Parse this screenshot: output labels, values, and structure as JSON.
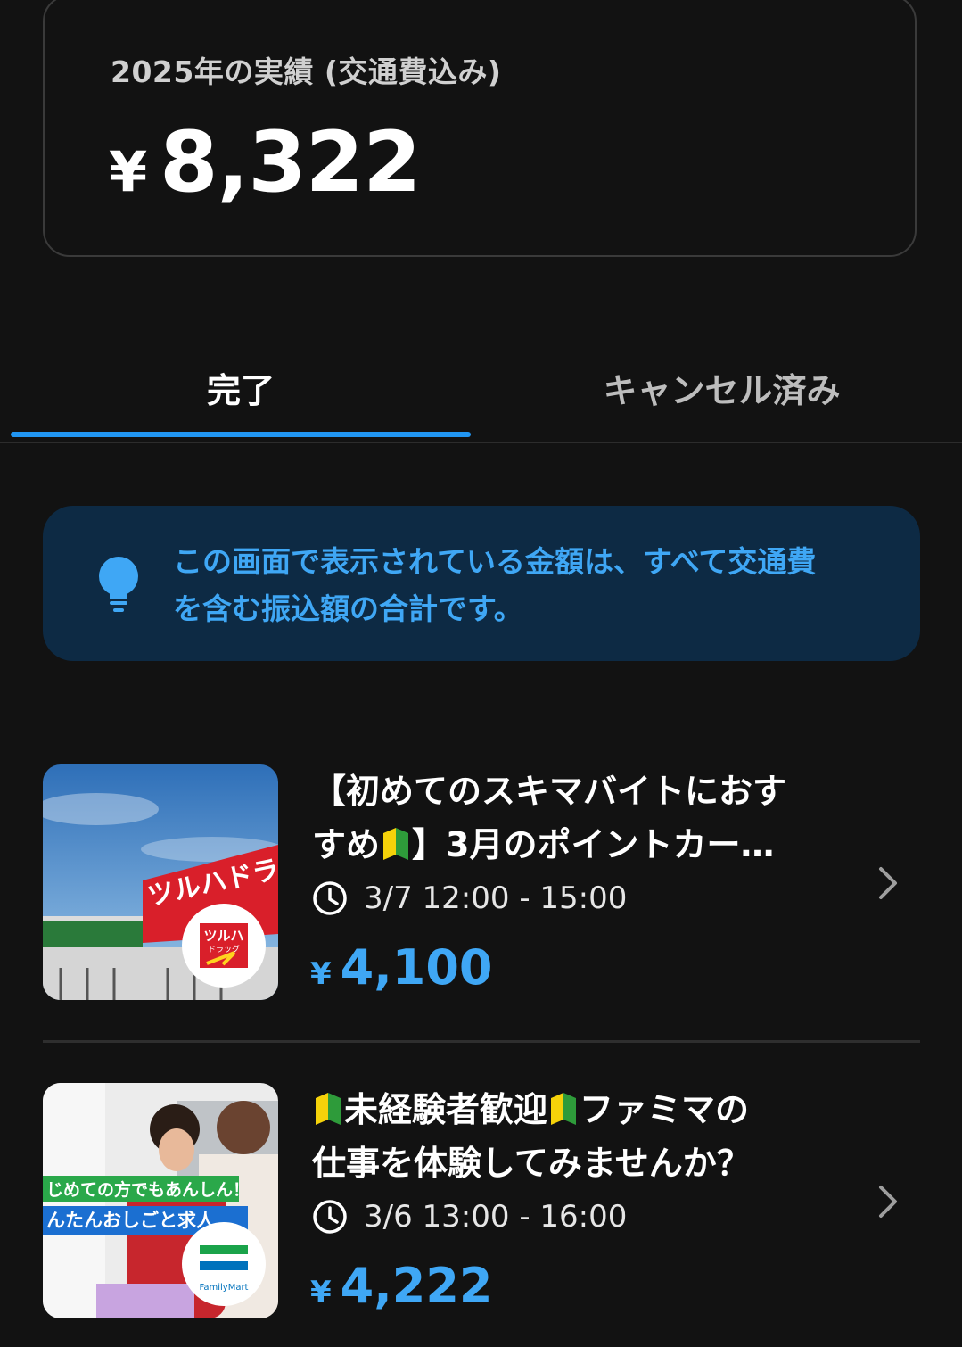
{
  "summary": {
    "label": "2025年の実績 (交通費込み)",
    "currency": "¥",
    "amount": "8,322"
  },
  "tabs": [
    {
      "label": "完了",
      "active": true
    },
    {
      "label": "キャンセル済み",
      "active": false
    }
  ],
  "info": {
    "icon": "lightbulb-icon",
    "text_line1": "この画面で表示されている金額は、すべて交通費",
    "text_line2": "を含む振込額の合計です。"
  },
  "jobs": [
    {
      "title_part1": "【初めてのスキマバイトにおす",
      "title_part2a": "すめ",
      "title_part2b": "】3月のポイントカー…",
      "time": "3/7 12:00 - 15:00",
      "currency": "¥",
      "pay": "4,100",
      "thumb_sign": "ツルハドラッグ",
      "thumb_logo_top": "ツルハ",
      "thumb_logo_bottom": "ドラッグ"
    },
    {
      "title_part1": "未経験者歓迎",
      "title_part2": "ファミマの",
      "title_line2": "仕事を体験してみませんか？",
      "time": "3/6 13:00 - 16:00",
      "currency": "¥",
      "pay": "4,222",
      "thumb_banner1": "じめての方でもあんしん！",
      "thumb_banner2": "んたんおしごと求人",
      "thumb_logo": "FamilyMart"
    }
  ],
  "colors": {
    "accent": "#2196f3",
    "info_bg": "#0d2a44",
    "info_text": "#3fa7f5",
    "background": "#121212"
  }
}
